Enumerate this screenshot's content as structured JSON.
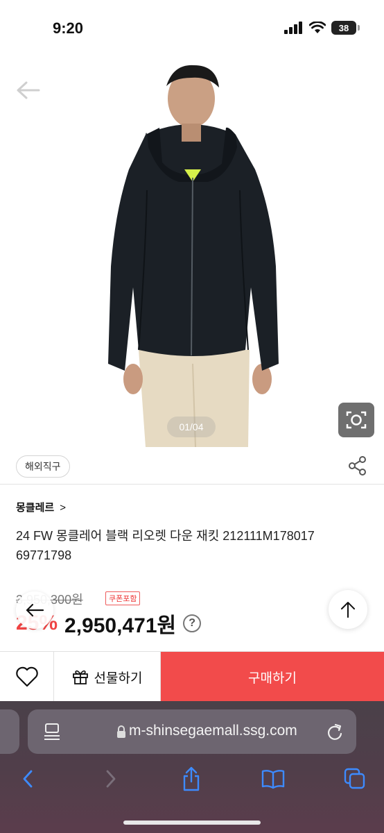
{
  "status": {
    "time": "9:20",
    "battery": "38"
  },
  "product": {
    "image_indicator": "01/04",
    "badge": "해외직구",
    "brand": "몽클레르",
    "brand_chevron": ">",
    "title": "24 FW 몽클레어 블랙 리오렛 다운 재킷 212111M178017 69771798",
    "original_price": "3,950,300원",
    "coupon_label": "쿠폰포함",
    "discount": "25%",
    "sale_price": "2,950,471원",
    "help": "?"
  },
  "actions": {
    "gift_label": "선물하기",
    "buy_label": "구매하기"
  },
  "browser": {
    "url": "m-shinsegaemall.ssg.com"
  },
  "colors": {
    "accent": "#f24b4b",
    "discount": "#f04444",
    "jacket": "#1b2026",
    "pants": "#e8dcc4"
  }
}
